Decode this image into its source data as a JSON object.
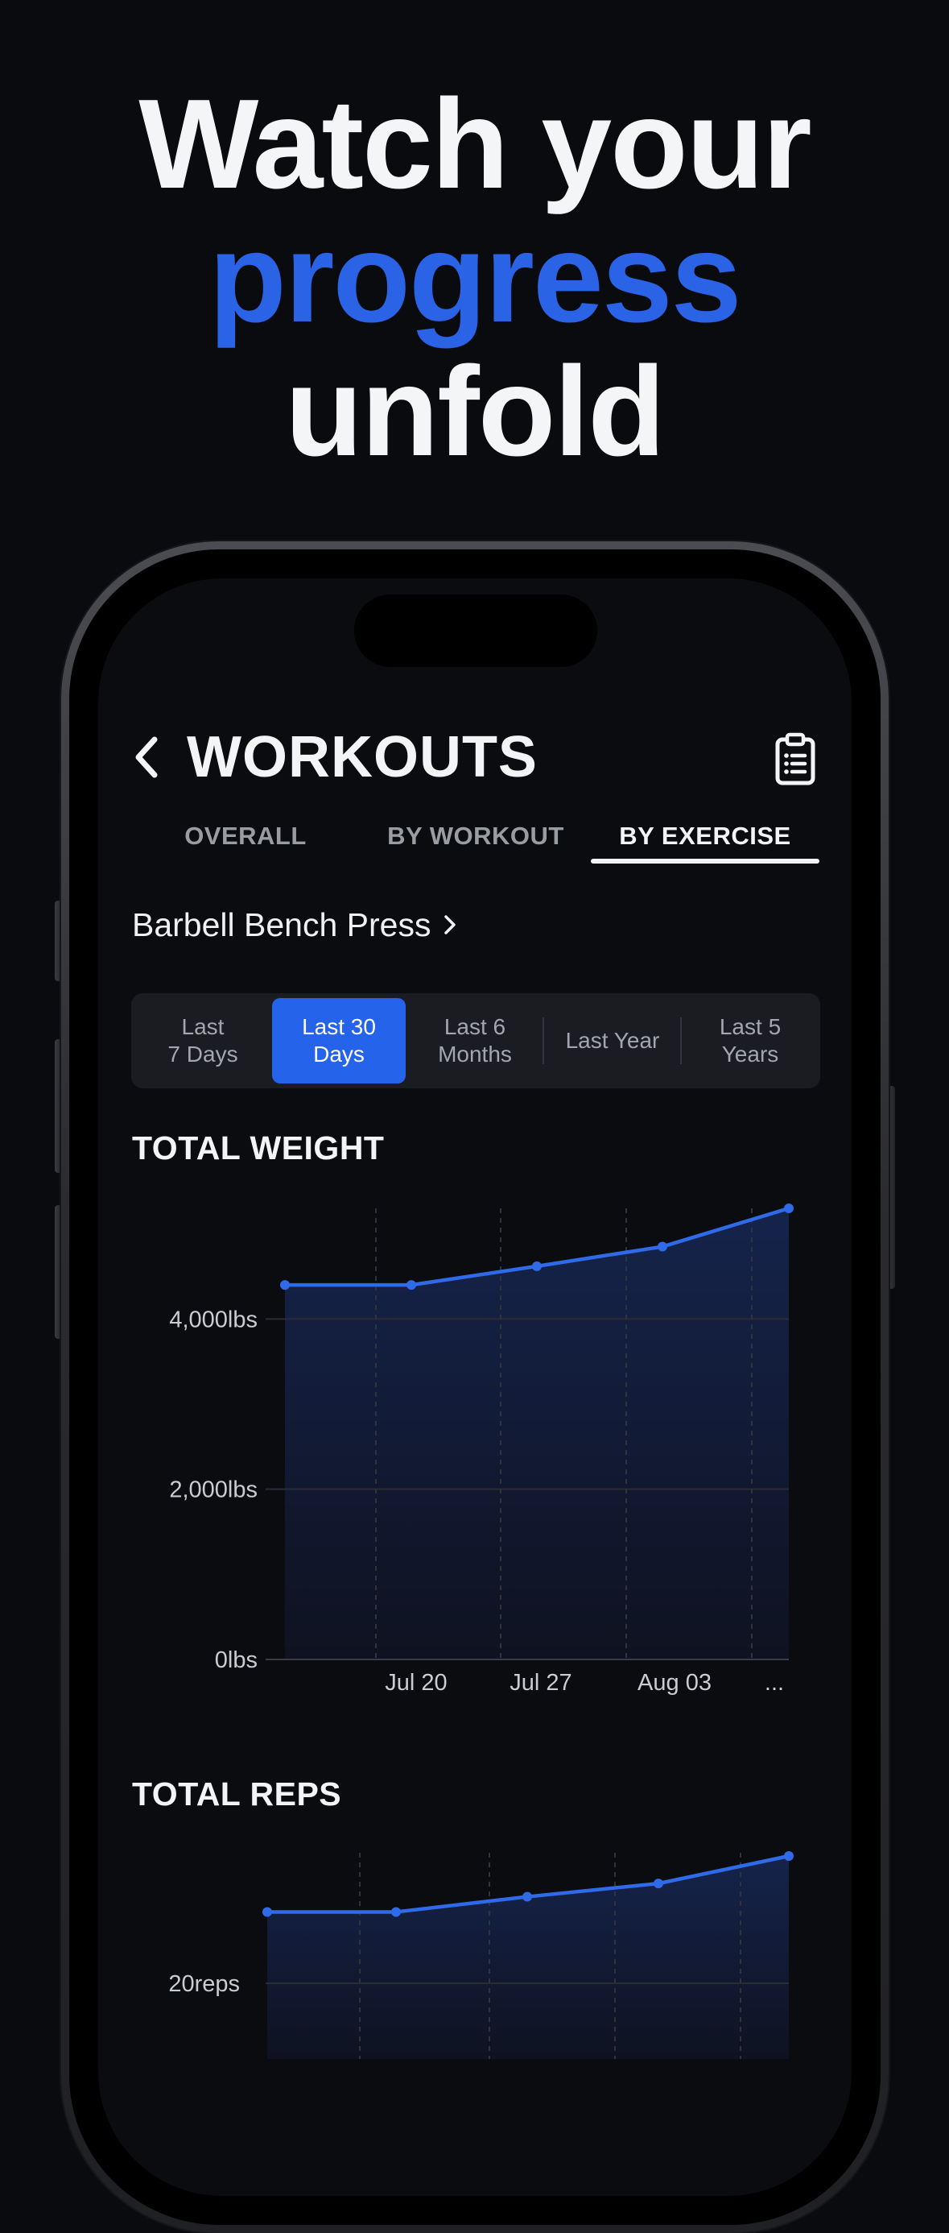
{
  "headline": {
    "line1": "Watch your",
    "line2": "progress",
    "line3": "unfold",
    "accent_color": "#2b63e6"
  },
  "header": {
    "title": "WORKOUTS",
    "back_icon": "chevron-left-icon",
    "action_icon": "clipboard-list-icon"
  },
  "tabs": [
    {
      "label": "OVERALL",
      "active": false
    },
    {
      "label": "BY WORKOUT",
      "active": false
    },
    {
      "label": "BY EXERCISE",
      "active": true
    }
  ],
  "exercise": {
    "name": "Barbell Bench Press",
    "icon": "chevron-right-icon"
  },
  "ranges": [
    {
      "label": "Last\n7 Days",
      "active": false
    },
    {
      "label": "Last 30\nDays",
      "active": true
    },
    {
      "label": "Last 6\nMonths",
      "active": false
    },
    {
      "label": "Last Year",
      "active": false
    },
    {
      "label": "Last 5\nYears",
      "active": false
    }
  ],
  "sections": {
    "weight_title": "TOTAL WEIGHT",
    "reps_title": "TOTAL REPS"
  },
  "colors": {
    "background": "#0b0c10",
    "accent": "#2563eb",
    "line": "#2f6ae8"
  },
  "chart_data": [
    {
      "type": "area",
      "title": "TOTAL WEIGHT",
      "x_ticks": [
        "Jul 20",
        "Jul 27",
        "Aug 03",
        "..."
      ],
      "y_ticks": [
        "4,000lbs",
        "2,000lbs",
        "0lbs"
      ],
      "y_tick_values": [
        4000,
        2000,
        0
      ],
      "ylim": [
        0,
        5300
      ],
      "values": [
        4400,
        4400,
        4620,
        4850,
        5300
      ],
      "grid": true
    },
    {
      "type": "area",
      "title": "TOTAL REPS",
      "y_ticks": [
        "20reps"
      ],
      "y_tick_values": [
        20
      ],
      "values": [
        27,
        27,
        28.5,
        29.8,
        32.5
      ],
      "grid": true
    }
  ]
}
